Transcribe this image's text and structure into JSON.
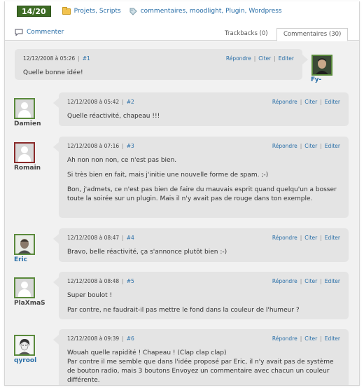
{
  "meta": {
    "score": "14/20",
    "categories": "Projets, Scripts",
    "tags": "commentaires, moodlight, Plugin, Wordpress"
  },
  "icons": {
    "category": "folder-icon",
    "tags": "tag-icon",
    "commenter": "speech-bubble-icon"
  },
  "colors": {
    "score_bg": "#3d6b24",
    "link": "#2a6fa8",
    "bubble": "#e4e4e4",
    "background": "#f1f1f1",
    "avatar_border_green": "#5a8a3c",
    "avatar_border_red": "#8a2a2a"
  },
  "tabs": {
    "commenter": "Commenter",
    "trackbacks": "Trackbacks (0)",
    "comments": "Commentaires (30)"
  },
  "actions": {
    "reply": "Répondre",
    "quote": "Citer",
    "edit": "Editer"
  },
  "comments": [
    {
      "author": "Fy-",
      "date": "12/12/2008 à 05:26",
      "num": "#1",
      "body": [
        "Quelle bonne idée!"
      ]
    },
    {
      "author": "Damien",
      "date": "12/12/2008 à 05:42",
      "num": "#2",
      "body": [
        "Quelle réactivité, chapeau !!!"
      ]
    },
    {
      "author": "Romain",
      "date": "12/12/2008 à 07:16",
      "num": "#3",
      "body": [
        "Ah non non non, ce n'est pas bien.",
        "Si très bien en fait, mais j'initie une nouvelle forme de spam. ;-)",
        "Bon, j'admets, ce n'est pas bien de faire du mauvais esprit quand quelqu'un a bosser toute la soirée sur un plugin. Mais il n'y avait pas de rouge dans ton exemple."
      ]
    },
    {
      "author": "Eric",
      "date": "12/12/2008 à 08:47",
      "num": "#4",
      "body": [
        "Bravo, belle réactivité, ça s'annonce plutôt bien :-)"
      ]
    },
    {
      "author": "PlaXmaS",
      "date": "12/12/2008 à 08:48",
      "num": "#5",
      "body": [
        "Super boulot !",
        "Par contre, ne faudrait-il pas mettre le fond dans la couleur de l'humeur ?"
      ]
    },
    {
      "author": "qyrool",
      "date": "12/12/2008 à 09:39",
      "num": "#6",
      "body": [
        "Wouah quelle rapidité ! Chapeau ! (Clap clap clap)",
        "Par contre il me semble que dans l'idée proposé par Eric, il n'y avait pas de système de bouton radio, mais 3 boutons Envoyez un commentaire avec chacun un couleur différente."
      ]
    }
  ]
}
